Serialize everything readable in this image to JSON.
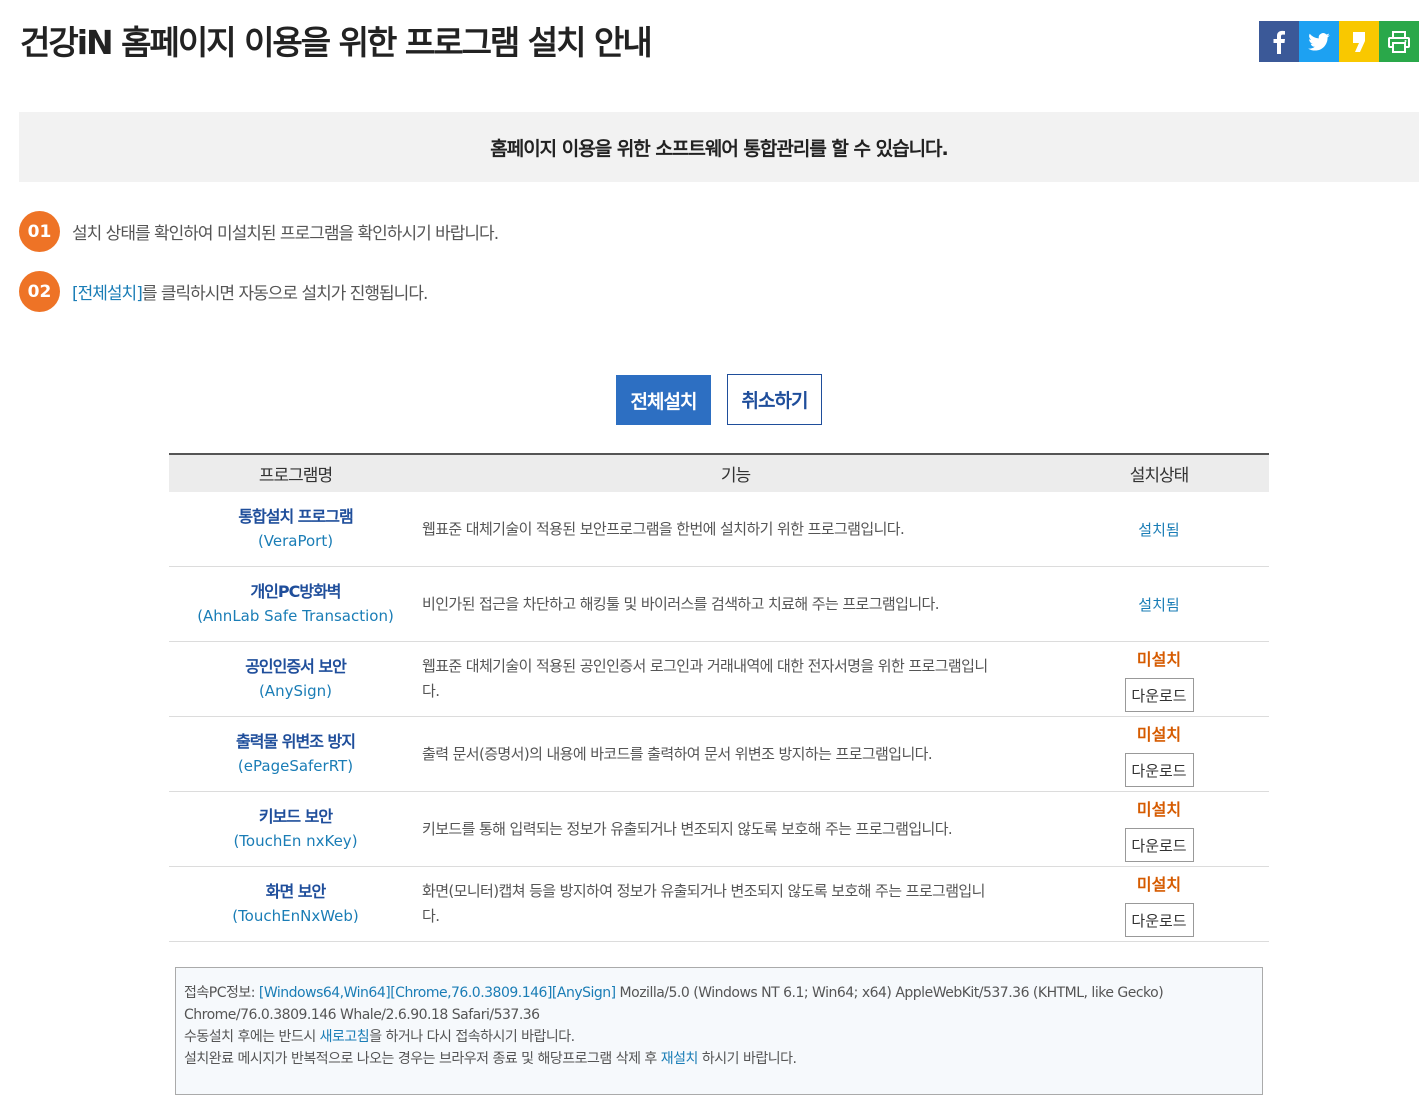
{
  "page": {
    "title": "건강iN 홈페이지 이용을 위한 프로그램 설치 안내"
  },
  "share": {
    "facebook_icon": "facebook-icon",
    "twitter_icon": "twitter-icon",
    "kakaostory_icon": "kakaostory-icon",
    "print_icon": "print-icon",
    "colors": {
      "facebook": "#3b5998",
      "twitter": "#1da1f2",
      "kakaostory": "#f9c800",
      "print": "#2aa84a"
    }
  },
  "banner": {
    "text": "홈페이지 이용을 위한 소프트웨어 통합관리를 할 수 있습니다."
  },
  "steps": [
    {
      "num": "01",
      "text": "설치 상태를 확인하여 미설치된 프로그램을 확인하시기 바랍니다."
    },
    {
      "num": "02",
      "link": "[전체설치]",
      "text": "를 클릭하시면 자동으로 설치가 진행됩니다."
    }
  ],
  "buttons": {
    "install_all": "전체설치",
    "cancel": "취소하기"
  },
  "table": {
    "headers": [
      "프로그램명",
      "기능",
      "설치상태"
    ],
    "rows": [
      {
        "name": "통합설치 프로그램",
        "sub": "(VeraPort)",
        "desc1": "웹표준 대체기술이 적용된 보안프로그램을 한번에 설치하기 위한 프로그램입니다.",
        "desc2": "",
        "status": "설치됨",
        "download": ""
      },
      {
        "name": "개인PC방화벽",
        "sub": "(AhnLab Safe Transaction)",
        "desc1": "비인가된 접근을 차단하고 해킹툴 및 바이러스를 검색하고 치료해 주는 프로그램입니다.",
        "desc2": "",
        "status": "설치됨",
        "download": ""
      },
      {
        "name": "공인인증서 보안",
        "sub": "(AnySign)",
        "desc1": "웹표준 대체기술이 적용된 공인인증서 로그인과 거래내역에 대한 전자서명을 위한 프로그램입니",
        "desc2": "다.",
        "status": "미설치",
        "download": "다운로드"
      },
      {
        "name": "출력물 위변조 방지",
        "sub": "(ePageSaferRT)",
        "desc1": "출력 문서(증명서)의 내용에 바코드를 출력하여 문서 위변조 방지하는 프로그램입니다.",
        "desc2": "",
        "status": "미설치",
        "download": "다운로드"
      },
      {
        "name": "키보드 보안",
        "sub": "(TouchEn nxKey)",
        "desc1": "키보드를 통해 입력되는 정보가 유출되거나 변조되지 않도록 보호해 주는 프로그램입니다.",
        "desc2": "",
        "status": "미설치",
        "download": "다운로드"
      },
      {
        "name": "화면 보안",
        "sub": "(TouchEnNxWeb)",
        "desc1": "화면(모니터)캡쳐 등을 방지하여 정보가 유출되거나 변조되지 않도록 보호해 주는 프로그램입니",
        "desc2": "다.",
        "status": "미설치",
        "download": "다운로드"
      }
    ]
  },
  "info": {
    "pc_label": "접속PC정보: ",
    "pc_tags": "[Windows64,Win64][Chrome,76.0.3809.146][AnySign]",
    "ua1": " Mozilla/5.0 (Windows NT 6.1; Win64; x64) AppleWebKit/537.36 (KHTML, like Gecko)",
    "ua2": "Chrome/76.0.3809.146 Whale/2.6.90.18 Safari/537.36",
    "line3_a": "수동설치 후에는 반드시 ",
    "refresh": "새로고침",
    "line3_b": "을 하거나 다시 접속하시기 바랍니다.",
    "line4_a": "설치완료 메시지가 반복적으로 나오는 경우는 브라우저 종료 및 해당프로그램 삭제 후 ",
    "reinstall": "재설치",
    "line4_b": " 하시기 바랍니다."
  }
}
